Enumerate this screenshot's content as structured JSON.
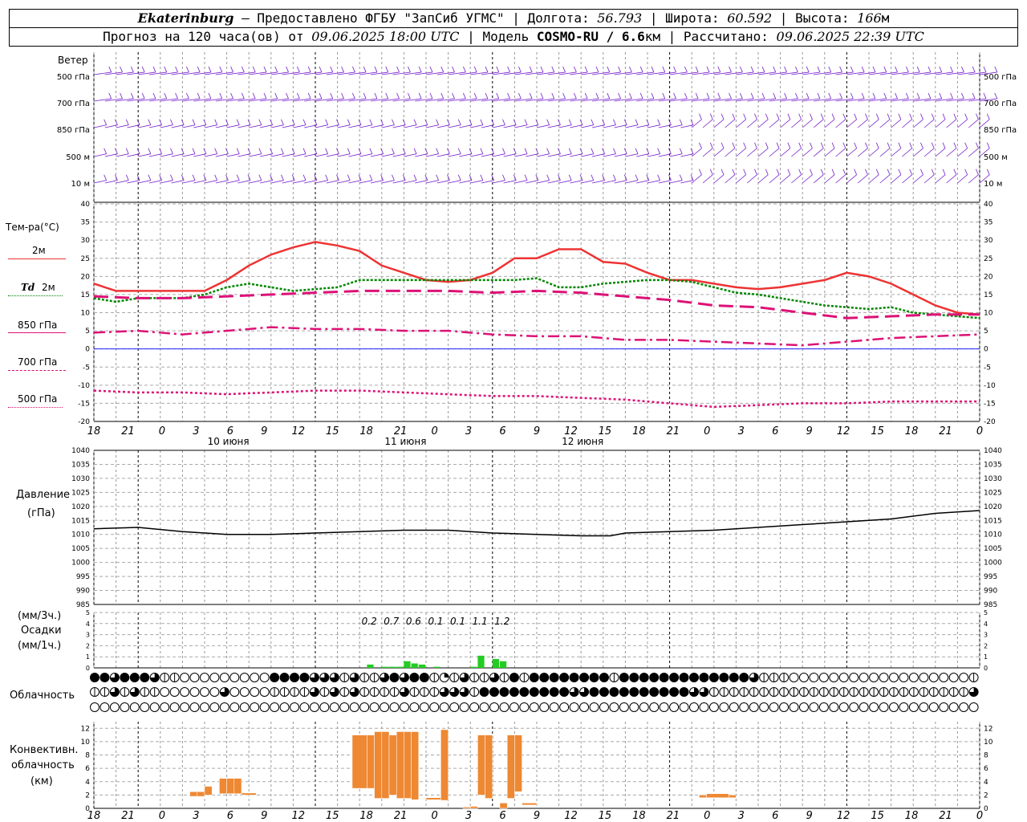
{
  "header": {
    "city": "Ekaterinburg",
    "provider": "— Предоставлено ФГБУ \"ЗапСиб УГМС\"",
    "lon_label": "Долгота:",
    "lon": "56.793",
    "lat_label": "Широта:",
    "lat": "60.592",
    "alt_label": "Высота:",
    "alt": "166",
    "alt_unit": "м",
    "forecast_label": "Прогноз на 120 часа(ов) от",
    "forecast_start": "09.06.2025 18:00 UTC",
    "model_label": "Модель",
    "model": "COSMO-RU / 6.6",
    "model_unit": "км",
    "calc_label": "Рассчитано:",
    "calc_time": "09.06.2025 22:39 UTC"
  },
  "labels": {
    "wind": "Ветер",
    "wind_levels": [
      "500 гПа",
      "700 гПа",
      "850 гПа",
      "500 м",
      "10 м"
    ],
    "temp": "Тем-ра(°C)",
    "t2m": "2м",
    "td": "Td",
    "td2m": "2м",
    "t850": "850 гПа",
    "t700": "700 гПа",
    "t500": "500 гПа",
    "pressure": "Давление",
    "pressure_unit": "(гПа)",
    "precip_rate1": "(мм/3ч.)",
    "precip": "Осадки",
    "precip_rate2": "(мм/1ч.)",
    "cloud": "Облачность",
    "conv1": "Конвективн.",
    "conv2": "облачность",
    "conv3": "(км)"
  },
  "colors": {
    "t2m": "#ee3333",
    "td": "#008800",
    "t850": "#dd1177",
    "t700": "#dd1177",
    "t500": "#dd1177",
    "pressure": "#000000",
    "wind": "#7722cc",
    "precip": "#22cc22",
    "conv": "#ee8833",
    "zero": "#2222ff"
  },
  "chart_data": [
    {
      "type": "line",
      "title": "Температура",
      "x_hours": "hours since 09.06.2025 18:00 UTC",
      "x_ticks": [
        "18",
        "21",
        "0",
        "3",
        "6",
        "9",
        "12",
        "15",
        "18",
        "21",
        "0",
        "3",
        "6",
        "9",
        "12",
        "15",
        "18",
        "21",
        "0",
        "3",
        "6",
        "9",
        "12",
        "15",
        "18",
        "21",
        "0"
      ],
      "day_labels": [
        "10 июня",
        "11 июня",
        "12 июня"
      ],
      "ylim": [
        -20,
        40
      ],
      "yticks": [
        -20,
        -15,
        -10,
        -5,
        0,
        5,
        10,
        15,
        20,
        25,
        30,
        35,
        40
      ],
      "series": [
        {
          "name": "2м",
          "key": "t2m",
          "x": [
            0,
            3,
            6,
            9,
            12,
            15,
            18,
            21,
            24,
            27,
            30,
            33,
            36,
            39,
            42,
            45,
            48,
            51,
            54,
            57,
            60,
            63,
            66,
            69,
            72,
            75,
            78,
            81,
            84,
            87,
            90,
            93,
            96,
            99,
            102,
            105,
            108,
            111,
            114,
            117,
            120
          ],
          "y": [
            18,
            16,
            16,
            16,
            16,
            16,
            19,
            23,
            26,
            28,
            29.5,
            28.5,
            27,
            23,
            21,
            19,
            18.5,
            19,
            21,
            25,
            25,
            27.5,
            27.5,
            24,
            23.5,
            21,
            19,
            19,
            18,
            17,
            16.5,
            17,
            18,
            19,
            21,
            20,
            18,
            15,
            12,
            10,
            9.5
          ]
        },
        {
          "name": "Td 2м",
          "key": "td",
          "x": [
            0,
            3,
            6,
            9,
            12,
            15,
            18,
            21,
            24,
            27,
            30,
            33,
            36,
            39,
            42,
            45,
            48,
            51,
            54,
            57,
            60,
            63,
            66,
            69,
            72,
            75,
            78,
            81,
            84,
            87,
            90,
            93,
            96,
            99,
            102,
            105,
            108,
            111,
            114,
            117,
            120
          ],
          "y": [
            14,
            13,
            14,
            14,
            14,
            15,
            17,
            18,
            17,
            16,
            16.5,
            17,
            19,
            19,
            19,
            19,
            19,
            19,
            19,
            19,
            19.5,
            17,
            17,
            18,
            18.5,
            19,
            19,
            18.5,
            17,
            15.5,
            15,
            14,
            13,
            12,
            11.5,
            11,
            11.5,
            10,
            9.5,
            9,
            8.5
          ]
        },
        {
          "name": "850 гПа",
          "key": "t850",
          "x": [
            0,
            6,
            12,
            18,
            24,
            30,
            36,
            42,
            48,
            54,
            60,
            66,
            72,
            78,
            84,
            90,
            96,
            102,
            108,
            114,
            120
          ],
          "y": [
            14.5,
            14,
            14,
            14.5,
            15,
            15.5,
            16,
            16,
            16,
            15.5,
            16,
            15.5,
            14.5,
            13.5,
            12,
            11.5,
            10,
            8.5,
            9,
            9.5,
            9.5
          ]
        },
        {
          "name": "700 гПа",
          "key": "t700",
          "x": [
            0,
            6,
            12,
            18,
            24,
            30,
            36,
            42,
            48,
            54,
            60,
            66,
            72,
            78,
            84,
            90,
            96,
            102,
            108,
            114,
            120
          ],
          "y": [
            4.5,
            5,
            4,
            5,
            6,
            5.5,
            5.5,
            5,
            5,
            4,
            3.5,
            3.5,
            2.5,
            2.5,
            2,
            1.5,
            1,
            2,
            3,
            3.5,
            4
          ]
        },
        {
          "name": "500 гПа",
          "key": "t500",
          "x": [
            0,
            6,
            12,
            18,
            24,
            30,
            36,
            42,
            48,
            54,
            60,
            66,
            72,
            78,
            84,
            90,
            96,
            102,
            108,
            114,
            120
          ],
          "y": [
            -11.5,
            -12,
            -12,
            -12.5,
            -12,
            -11.5,
            -11.5,
            -12,
            -12.5,
            -13,
            -13,
            -13.5,
            -14,
            -15,
            -16,
            -15.5,
            -15,
            -15,
            -14.5,
            -14.5,
            -14.5
          ]
        }
      ]
    },
    {
      "type": "line",
      "title": "Давление (гПа)",
      "ylim": [
        985,
        1040
      ],
      "yticks": [
        985,
        990,
        995,
        1000,
        1005,
        1010,
        1015,
        1020,
        1025,
        1030,
        1035,
        1040
      ],
      "series": [
        {
          "name": "Давление",
          "key": "pressure",
          "x": [
            0,
            6,
            12,
            18,
            24,
            30,
            36,
            42,
            48,
            54,
            60,
            66,
            70,
            72,
            78,
            84,
            90,
            96,
            102,
            108,
            114,
            120
          ],
          "y": [
            1012,
            1012.5,
            1011,
            1010,
            1010,
            1010.5,
            1011,
            1011.5,
            1011.5,
            1010.5,
            1010,
            1009.5,
            1009.5,
            1010.5,
            1011,
            1011.5,
            1012.5,
            1013.5,
            1014.5,
            1015.5,
            1017.5,
            1018.5
          ]
        }
      ]
    },
    {
      "type": "bar",
      "title": "Осадки",
      "ylim": [
        0,
        5
      ],
      "yticks": [
        0,
        1,
        2,
        3,
        4,
        5
      ],
      "bar_hours": [
        37,
        39,
        40,
        41,
        42,
        43,
        44,
        46,
        51,
        52,
        54,
        55
      ],
      "bar_values": [
        0.3,
        0.1,
        0.1,
        0.1,
        0.6,
        0.4,
        0.3,
        0.1,
        0.1,
        1.1,
        0.8,
        0.6
      ],
      "totals_3h": [
        "0.2",
        "0.7",
        "0.6",
        "0.1",
        "0.1",
        "1.1",
        "1.2"
      ]
    },
    {
      "type": "bar",
      "title": "Конвективн. облачность (км)",
      "ylim": [
        0,
        13
      ],
      "yticks": [
        0,
        2,
        4,
        6,
        8,
        10,
        12
      ],
      "columns": [
        {
          "h0": 13,
          "h1": 14,
          "bottom": 1.8,
          "top": 2.5
        },
        {
          "h0": 14,
          "h1": 15,
          "bottom": 1.8,
          "top": 2.5
        },
        {
          "h0": 15,
          "h1": 16,
          "bottom": 2.0,
          "top": 3.3
        },
        {
          "h0": 17,
          "h1": 18,
          "bottom": 2.2,
          "top": 4.5
        },
        {
          "h0": 18,
          "h1": 19,
          "bottom": 2.2,
          "top": 4.5
        },
        {
          "h0": 19,
          "h1": 20,
          "bottom": 2.2,
          "top": 4.5
        },
        {
          "h0": 20,
          "h1": 22,
          "bottom": 2.0,
          "top": 2.3
        },
        {
          "h0": 35,
          "h1": 37,
          "bottom": 3.0,
          "top": 11.0
        },
        {
          "h0": 37,
          "h1": 38,
          "bottom": 3.0,
          "top": 11.0
        },
        {
          "h0": 38,
          "h1": 39,
          "bottom": 1.5,
          "top": 11.5
        },
        {
          "h0": 39,
          "h1": 40,
          "bottom": 1.5,
          "top": 11.5
        },
        {
          "h0": 40,
          "h1": 41,
          "bottom": 2.0,
          "top": 11.0
        },
        {
          "h0": 41,
          "h1": 42,
          "bottom": 1.5,
          "top": 11.5
        },
        {
          "h0": 42,
          "h1": 43,
          "bottom": 1.5,
          "top": 11.5
        },
        {
          "h0": 43,
          "h1": 44,
          "bottom": 1.3,
          "top": 11.5
        },
        {
          "h0": 45,
          "h1": 47,
          "bottom": 1.3,
          "top": 1.6
        },
        {
          "h0": 47,
          "h1": 48,
          "bottom": 1.2,
          "top": 11.8
        },
        {
          "h0": 50,
          "h1": 51,
          "bottom": 0,
          "top": 0.2
        },
        {
          "h0": 51,
          "h1": 52,
          "bottom": 0,
          "top": 0.3
        },
        {
          "h0": 52,
          "h1": 53,
          "bottom": 2.0,
          "top": 11.0
        },
        {
          "h0": 53,
          "h1": 54,
          "bottom": 1.5,
          "top": 11.0
        },
        {
          "h0": 55,
          "h1": 56,
          "bottom": 0,
          "top": 0.8
        },
        {
          "h0": 56,
          "h1": 57,
          "bottom": 1.5,
          "top": 11.0
        },
        {
          "h0": 57,
          "h1": 58,
          "bottom": 2.5,
          "top": 11.0
        },
        {
          "h0": 58,
          "h1": 60,
          "bottom": 0.5,
          "top": 0.8
        },
        {
          "h0": 82,
          "h1": 83,
          "bottom": 1.6,
          "top": 2.0
        },
        {
          "h0": 83,
          "h1": 86,
          "bottom": 1.6,
          "top": 2.2
        },
        {
          "h0": 86,
          "h1": 87,
          "bottom": 1.6,
          "top": 2.0
        }
      ]
    }
  ],
  "clouds": {
    "upper": [
      4,
      4,
      3,
      4,
      4,
      4,
      3,
      2,
      2,
      0,
      0,
      0,
      0,
      0,
      0,
      0,
      0,
      0,
      4,
      4,
      4,
      4,
      3,
      3,
      3,
      2,
      3,
      2,
      2,
      3,
      4,
      3,
      4,
      4,
      2,
      1,
      2,
      3,
      2,
      2,
      3,
      2,
      4,
      2,
      4,
      4,
      4,
      4,
      4,
      4,
      4,
      4,
      2,
      4,
      4,
      4,
      4,
      4,
      4,
      4,
      4,
      4,
      4,
      4,
      4,
      4,
      3,
      2,
      2,
      2,
      0,
      0,
      0,
      0,
      0,
      0,
      0,
      0,
      0,
      0,
      0,
      0,
      0,
      0,
      0,
      0,
      0,
      0,
      2
    ],
    "middle": [
      2,
      2,
      3,
      2,
      3,
      2,
      2,
      0,
      0,
      0,
      0,
      0,
      0,
      3,
      0,
      0,
      0,
      0,
      2,
      2,
      2,
      2,
      3,
      2,
      3,
      2,
      3,
      2,
      2,
      2,
      2,
      3,
      2,
      2,
      2,
      3,
      3,
      3,
      2,
      4,
      4,
      4,
      4,
      4,
      4,
      4,
      4,
      4,
      3,
      3,
      4,
      4,
      4,
      4,
      4,
      4,
      4,
      4,
      4,
      4,
      3,
      3,
      2,
      2,
      2,
      2,
      2,
      2,
      2,
      2,
      2,
      2,
      2,
      2,
      2,
      2,
      2,
      2,
      2,
      2,
      2,
      2,
      2,
      2,
      2,
      2,
      2,
      2,
      3
    ],
    "lower": [
      0,
      0,
      0,
      0,
      0,
      0,
      0,
      0,
      0,
      0,
      0,
      0,
      0,
      0,
      0,
      0,
      0,
      0,
      0,
      0,
      0,
      0,
      0,
      0,
      0,
      0,
      0,
      0,
      0,
      0,
      0,
      0,
      0,
      0,
      0,
      0,
      0,
      0,
      0,
      0,
      0,
      0,
      0,
      0,
      0,
      0,
      0,
      0,
      0,
      0,
      0,
      0,
      0,
      0,
      0,
      0,
      0,
      0,
      0,
      0,
      0,
      0,
      0,
      0,
      0,
      0,
      0,
      0,
      0,
      0,
      0,
      0,
      0,
      0,
      0,
      0,
      0,
      0,
      0,
      0,
      0,
      0,
      0,
      0,
      0,
      0,
      0,
      0,
      0
    ]
  }
}
